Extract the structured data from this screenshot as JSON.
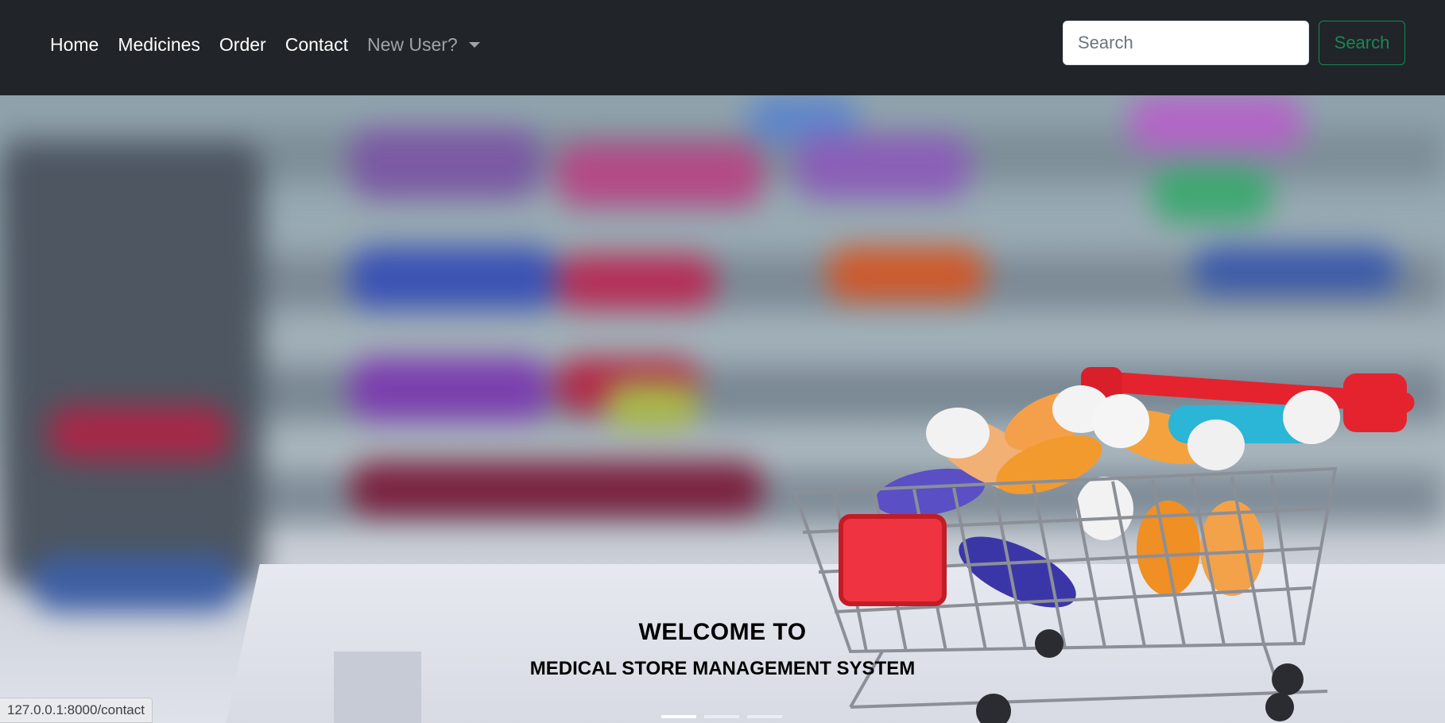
{
  "navbar": {
    "links": [
      "Home",
      "Medicines",
      "Order",
      "Contact"
    ],
    "dropdown_label": "New User?",
    "search": {
      "placeholder": "Search",
      "value": ""
    },
    "search_button_label": "Search"
  },
  "hero": {
    "title": "WELCOME TO",
    "subtitle": "MEDICAL STORE MANAGEMENT SYSTEM",
    "image_icon": "pharmacy-shopping-cart-with-pills",
    "slides_count": 3,
    "active_slide": 0
  },
  "status_bar": {
    "url": "127.0.0.1:8000/contact"
  },
  "colors": {
    "navbar_bg": "#212529",
    "search_button": "#198754",
    "muted_link": "#9ea4aa"
  }
}
